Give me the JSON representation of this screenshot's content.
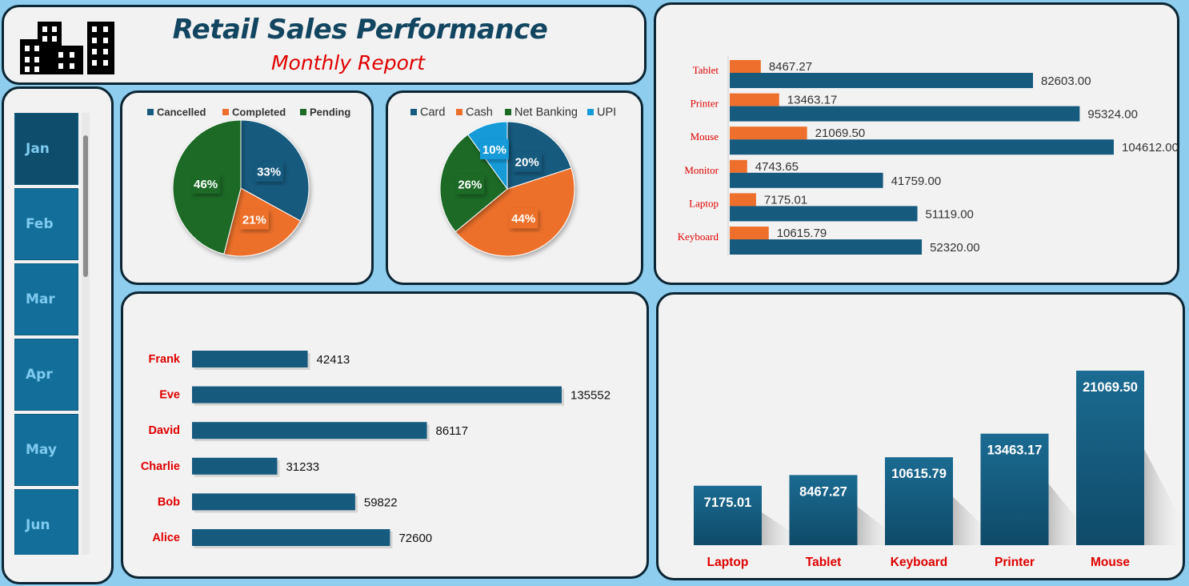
{
  "header": {
    "title": "Retail Sales Performance",
    "subtitle": "Monthly Report",
    "logo_icon": "buildings-icon"
  },
  "slicer": {
    "months": [
      "Jan",
      "Feb",
      "Mar",
      "Apr",
      "May",
      "Jun"
    ],
    "selected": "Jan"
  },
  "colors": {
    "navy": "#134f6e",
    "orange": "#ed6f2b",
    "green": "#1c6b25",
    "cyan": "#159ad8",
    "red_label": "#e00000"
  },
  "chart_data": [
    {
      "id": "order-status",
      "type": "pie",
      "categories": [
        "Cancelled",
        "Completed",
        "Pending"
      ],
      "values": [
        33,
        21,
        46
      ],
      "data_labels": [
        "33%",
        "21%",
        "46%"
      ],
      "colors": [
        "#165a7e",
        "#ed6f2b",
        "#1c6b25"
      ],
      "legend": "top"
    },
    {
      "id": "payment-method",
      "type": "pie",
      "categories": [
        "Card",
        "Cash",
        "Net Banking",
        "UPI"
      ],
      "values": [
        20,
        44,
        26,
        10
      ],
      "data_labels": [
        "20%",
        "44%",
        "26%",
        "10%"
      ],
      "colors": [
        "#165a7e",
        "#ed6f2b",
        "#1c6b25",
        "#159ad8"
      ],
      "legend": "top"
    },
    {
      "id": "product-sales-profit",
      "type": "bar",
      "orientation": "horizontal",
      "categories": [
        "Tablet",
        "Printer",
        "Mouse",
        "Monitor",
        "Laptop",
        "Keyboard"
      ],
      "series": [
        {
          "values": [
            8467.27,
            13463.17,
            21069.5,
            4743.65,
            7175.01,
            10615.79
          ],
          "labels": [
            "8467.27",
            "13463.17",
            "21069.50",
            "4743.65",
            "7175.01",
            "10615.79"
          ],
          "color": "#ed6f2b"
        },
        {
          "values": [
            82603.0,
            95324.0,
            104612.0,
            41759.0,
            51119.0,
            52320.0
          ],
          "labels": [
            "82603.00",
            "95324.00",
            "104612.00",
            "41759.00",
            "51119.00",
            "52320.00"
          ],
          "color": "#165a7e"
        }
      ]
    },
    {
      "id": "customer-sales",
      "type": "bar",
      "orientation": "horizontal",
      "categories": [
        "Frank",
        "Eve",
        "David",
        "Charlie",
        "Bob",
        "Alice"
      ],
      "values": [
        42413,
        135552,
        86117,
        31233,
        59822,
        72600
      ],
      "labels": [
        "42413",
        "135552",
        "86117",
        "31233",
        "59822",
        "72600"
      ]
    },
    {
      "id": "product-profit",
      "type": "bar",
      "orientation": "vertical",
      "categories": [
        "Laptop",
        "Tablet",
        "Keyboard",
        "Printer",
        "Mouse"
      ],
      "values": [
        7175.01,
        8467.27,
        10615.79,
        13463.17,
        21069.5
      ],
      "labels": [
        "7175.01",
        "8467.27",
        "10615.79",
        "13463.17",
        "21069.50"
      ]
    }
  ]
}
